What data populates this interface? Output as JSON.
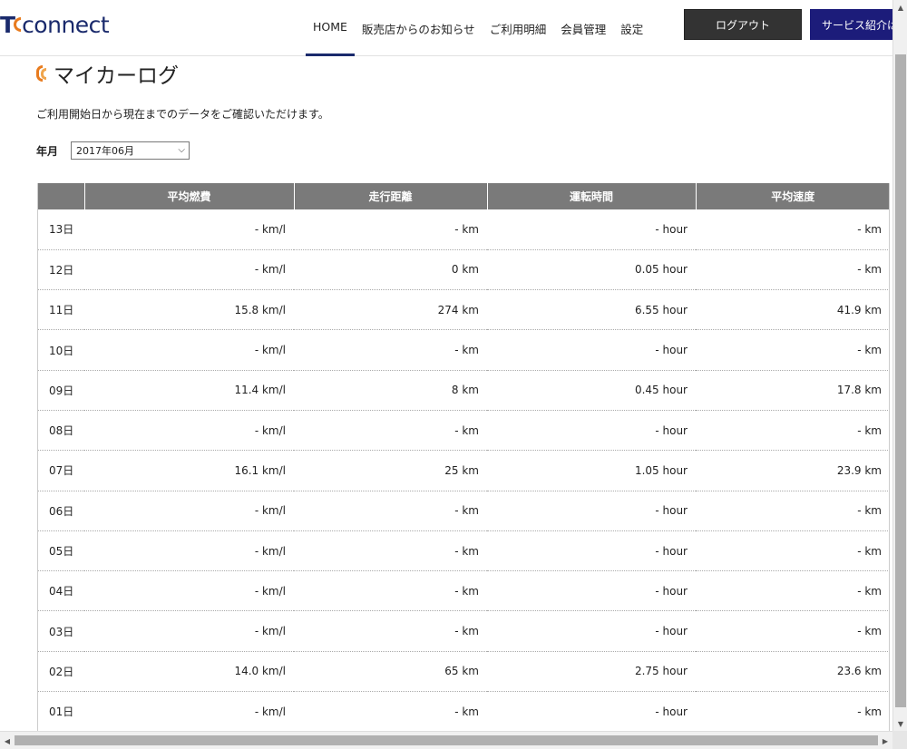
{
  "header": {
    "logo_t": "T",
    "logo_rest": "connect",
    "nav": [
      {
        "label": "HOME",
        "active": true
      },
      {
        "label": "販売店からのお知らせ"
      },
      {
        "label": "ご利用明細"
      },
      {
        "label": "会員管理"
      },
      {
        "label": "設定"
      }
    ],
    "logout_label": "ログアウト",
    "service_label": "サービス紹介はこ"
  },
  "page": {
    "title": "マイカーログ",
    "lead": "ご利用開始日から現在までのデータをご確認いただけます。",
    "filter_label": "年月",
    "selected_month": "2017年06月"
  },
  "table": {
    "headers": [
      "",
      "平均燃費",
      "走行距離",
      "運転時間",
      "平均速度"
    ],
    "rows": [
      [
        "13日",
        "- km/l",
        "- km",
        "- hour",
        "- km"
      ],
      [
        "12日",
        "- km/l",
        "0 km",
        "0.05 hour",
        "- km"
      ],
      [
        "11日",
        "15.8 km/l",
        "274 km",
        "6.55 hour",
        "41.9 km"
      ],
      [
        "10日",
        "- km/l",
        "- km",
        "- hour",
        "- km"
      ],
      [
        "09日",
        "11.4 km/l",
        "8 km",
        "0.45 hour",
        "17.8 km"
      ],
      [
        "08日",
        "- km/l",
        "- km",
        "- hour",
        "- km"
      ],
      [
        "07日",
        "16.1 km/l",
        "25 km",
        "1.05 hour",
        "23.9 km"
      ],
      [
        "06日",
        "- km/l",
        "- km",
        "- hour",
        "- km"
      ],
      [
        "05日",
        "- km/l",
        "- km",
        "- hour",
        "- km"
      ],
      [
        "04日",
        "- km/l",
        "- km",
        "- hour",
        "- km"
      ],
      [
        "03日",
        "- km/l",
        "- km",
        "- hour",
        "- km"
      ],
      [
        "02日",
        "14.0 km/l",
        "65 km",
        "2.75 hour",
        "23.6 km"
      ],
      [
        "01日",
        "- km/l",
        "- km",
        "- hour",
        "- km"
      ]
    ]
  },
  "colors": {
    "brand_navy": "#1a2a6c",
    "accent_orange": "#e87b1e",
    "table_header": "#7a7a7a",
    "logout_bg": "#333333",
    "service_bg": "#1c1c7a"
  }
}
